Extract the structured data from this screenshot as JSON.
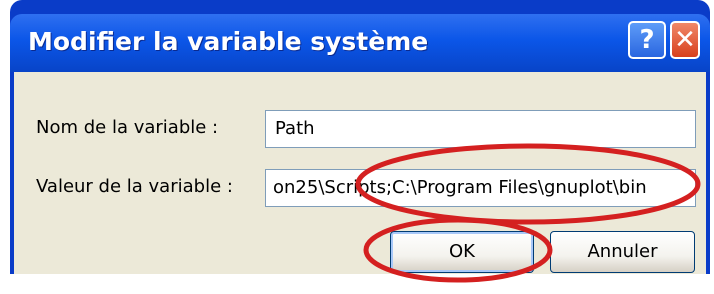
{
  "dialog": {
    "title": "Modifier la variable système",
    "help_glyph": "?",
    "close_glyph": "✕"
  },
  "form": {
    "name_label": "Nom de la variable :",
    "name_value": "Path",
    "value_label": "Valeur de la variable :",
    "value_value": "on25\\Scripts;C:\\Program Files\\gnuplot\\bin"
  },
  "buttons": {
    "ok_label": "OK",
    "cancel_label": "Annuler"
  },
  "annotation": {
    "color": "#d42020"
  }
}
